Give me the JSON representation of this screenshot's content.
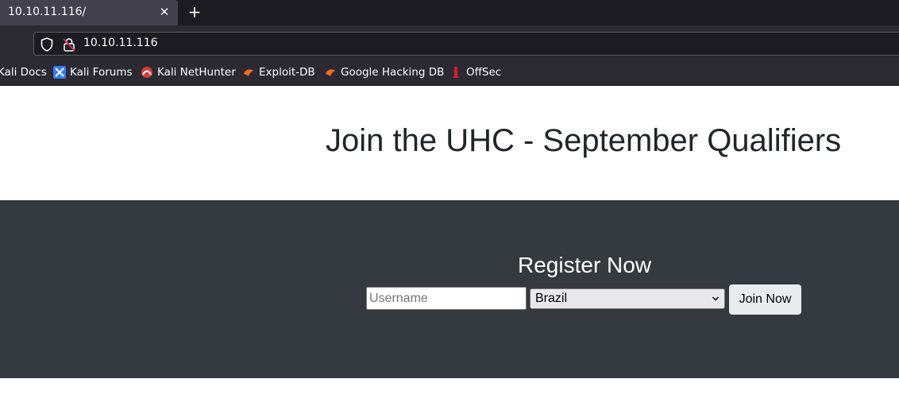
{
  "browser": {
    "tab": {
      "title": "10.10.11.116/",
      "close_symbol": "✕"
    },
    "new_tab_symbol": "+",
    "url": "10.10.11.116",
    "bookmarks": [
      {
        "label": "Kali Docs",
        "icon": "none"
      },
      {
        "label": "Kali Forums",
        "icon": "kali-forums-icon"
      },
      {
        "label": "Kali NetHunter",
        "icon": "kali-nethunter-icon"
      },
      {
        "label": "Exploit-DB",
        "icon": "exploit-db-icon"
      },
      {
        "label": "Google Hacking DB",
        "icon": "exploit-db-icon"
      },
      {
        "label": "OffSec",
        "icon": "offsec-icon"
      }
    ]
  },
  "page": {
    "title": "Join the UHC - September Qualifiers",
    "register": {
      "heading": "Register Now",
      "username_placeholder": "Username",
      "username_value": "",
      "country_selected": "Brazil",
      "join_label": "Join Now"
    }
  },
  "colors": {
    "tabbar_bg": "#1c1b22",
    "chrome_bg": "#2b2a33",
    "dark_section_bg": "#343a40",
    "title_text": "#212529"
  }
}
